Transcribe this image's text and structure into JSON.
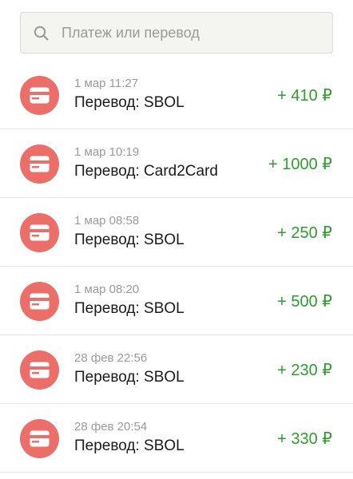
{
  "search": {
    "placeholder": "Платеж или перевод",
    "icon": "search-icon"
  },
  "colors": {
    "accent_avatar": "#ec6e68",
    "amount_positive": "#2e9e2e",
    "date_text": "#9a9a9a",
    "title_text": "#1a1a1a"
  },
  "transactions": [
    {
      "date": "1 мар 11:27",
      "title": "Перевод: SBOL",
      "amount": "+ 410 ₽",
      "icon": "bank-card-icon"
    },
    {
      "date": "1 мар 10:19",
      "title": "Перевод: Card2Card",
      "amount": "+ 1000 ₽",
      "icon": "bank-card-icon"
    },
    {
      "date": "1 мар 08:58",
      "title": "Перевод: SBOL",
      "amount": "+ 250 ₽",
      "icon": "bank-card-icon"
    },
    {
      "date": "1 мар 08:20",
      "title": "Перевод: SBOL",
      "amount": "+ 500 ₽",
      "icon": "bank-card-icon"
    },
    {
      "date": "28 фев 22:56",
      "title": "Перевод: SBOL",
      "amount": "+ 230 ₽",
      "icon": "bank-card-icon"
    },
    {
      "date": "28 фев 20:54",
      "title": "Перевод: SBOL",
      "amount": "+ 330 ₽",
      "icon": "bank-card-icon"
    }
  ]
}
